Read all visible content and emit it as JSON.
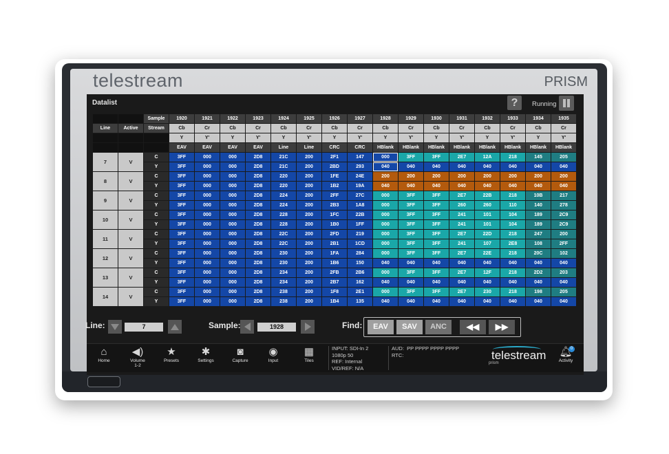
{
  "header": {
    "brand": "telestream",
    "product": "PRISM"
  },
  "app": {
    "title": "Datalist",
    "help_label": "?",
    "status": "Running"
  },
  "table": {
    "labels": {
      "sample": "Sample",
      "line": "Line",
      "active": "Active",
      "stream": "Stream"
    },
    "samples": [
      "1920",
      "1921",
      "1922",
      "1923",
      "1924",
      "1925",
      "1926",
      "1927",
      "1928",
      "1929",
      "1930",
      "1931",
      "1932",
      "1933",
      "1934",
      "1935"
    ],
    "streams": [
      "Cb",
      "Cr",
      "Cb",
      "Cr",
      "Cb",
      "Cr",
      "Cb",
      "Cr",
      "Cb",
      "Cr",
      "Cb",
      "Cr",
      "Cb",
      "Cr",
      "Cb",
      "Cr"
    ],
    "ys": [
      "Y",
      "Y'",
      "Y",
      "Y'",
      "Y",
      "Y'",
      "Y",
      "Y'",
      "Y",
      "Y'",
      "Y",
      "Y'",
      "Y",
      "Y'",
      "Y",
      "Y'"
    ],
    "types": [
      "EAV",
      "EAV",
      "EAV",
      "EAV",
      "Line",
      "Line",
      "CRC",
      "CRC",
      "HBlank",
      "HBlank",
      "HBlank",
      "HBlank",
      "HBlank",
      "HBlank",
      "HBlank",
      "HBlank"
    ],
    "rows": [
      {
        "line": "7",
        "active": "V",
        "c": [
          "3FF",
          "000",
          "000",
          "2D8",
          "21C",
          "200",
          "2F1",
          "147",
          "000",
          "3FF",
          "3FF",
          "2E7",
          "12A",
          "218",
          "145",
          "205"
        ],
        "y": [
          "3FF",
          "000",
          "000",
          "2D8",
          "21C",
          "200",
          "2BD",
          "293",
          "040",
          "040",
          "040",
          "040",
          "040",
          "040",
          "040",
          "040"
        ]
      },
      {
        "line": "8",
        "active": "V",
        "c": [
          "3FF",
          "000",
          "000",
          "2D8",
          "220",
          "200",
          "1FE",
          "24E",
          "200",
          "200",
          "200",
          "200",
          "200",
          "200",
          "200",
          "200"
        ],
        "y": [
          "3FF",
          "000",
          "000",
          "2D8",
          "220",
          "200",
          "1B2",
          "19A",
          "040",
          "040",
          "040",
          "040",
          "040",
          "040",
          "040",
          "040"
        ]
      },
      {
        "line": "9",
        "active": "V",
        "c": [
          "3FF",
          "000",
          "000",
          "2D8",
          "224",
          "200",
          "2FF",
          "27C",
          "000",
          "3FF",
          "3FF",
          "2E7",
          "22B",
          "218",
          "10B",
          "217"
        ],
        "y": [
          "3FF",
          "000",
          "000",
          "2D8",
          "224",
          "200",
          "2B3",
          "1A8",
          "000",
          "3FF",
          "3FF",
          "260",
          "260",
          "110",
          "140",
          "278"
        ]
      },
      {
        "line": "10",
        "active": "V",
        "c": [
          "3FF",
          "000",
          "000",
          "2D8",
          "228",
          "200",
          "1FC",
          "22B",
          "000",
          "3FF",
          "3FF",
          "241",
          "101",
          "104",
          "189",
          "2C9"
        ],
        "y": [
          "3FF",
          "000",
          "000",
          "2D8",
          "228",
          "200",
          "1B0",
          "1FF",
          "000",
          "3FF",
          "3FF",
          "241",
          "101",
          "104",
          "189",
          "2C9"
        ]
      },
      {
        "line": "11",
        "active": "V",
        "c": [
          "3FF",
          "000",
          "000",
          "2D8",
          "22C",
          "200",
          "2FD",
          "219",
          "000",
          "3FF",
          "3FF",
          "2E7",
          "22D",
          "218",
          "247",
          "200"
        ],
        "y": [
          "3FF",
          "000",
          "000",
          "2D8",
          "22C",
          "200",
          "2B1",
          "1CD",
          "000",
          "3FF",
          "3FF",
          "241",
          "107",
          "2E8",
          "108",
          "2FF"
        ]
      },
      {
        "line": "12",
        "active": "V",
        "c": [
          "3FF",
          "000",
          "000",
          "2D8",
          "230",
          "200",
          "1FA",
          "284",
          "000",
          "3FF",
          "3FF",
          "2E7",
          "22E",
          "218",
          "20C",
          "102"
        ],
        "y": [
          "3FF",
          "000",
          "000",
          "2D8",
          "230",
          "200",
          "1B6",
          "150",
          "040",
          "040",
          "040",
          "040",
          "040",
          "040",
          "040",
          "040"
        ]
      },
      {
        "line": "13",
        "active": "V",
        "c": [
          "3FF",
          "000",
          "000",
          "2D8",
          "234",
          "200",
          "2FB",
          "2B6",
          "000",
          "3FF",
          "3FF",
          "2E7",
          "12F",
          "218",
          "2D2",
          "203"
        ],
        "y": [
          "3FF",
          "000",
          "000",
          "2D8",
          "234",
          "200",
          "2B7",
          "162",
          "040",
          "040",
          "040",
          "040",
          "040",
          "040",
          "040",
          "040"
        ]
      },
      {
        "line": "14",
        "active": "V",
        "c": [
          "3FF",
          "000",
          "000",
          "2D8",
          "238",
          "200",
          "1F8",
          "2E1",
          "000",
          "3FF",
          "3FF",
          "2E7",
          "230",
          "218",
          "198",
          "205"
        ],
        "y": [
          "3FF",
          "000",
          "000",
          "2D8",
          "238",
          "200",
          "1B4",
          "135",
          "040",
          "040",
          "040",
          "040",
          "040",
          "040",
          "040",
          "040"
        ]
      }
    ],
    "row_labels": {
      "c": "C",
      "y": "Y"
    }
  },
  "controls": {
    "line_label": "Line:",
    "line_value": "7",
    "sample_label": "Sample:",
    "sample_value": "1928",
    "find_label": "Find:",
    "eav": "EAV",
    "sav": "SAV",
    "anc": "ANC",
    "prev": "◀◀",
    "next": "▶▶"
  },
  "taskbar": {
    "items": [
      {
        "label": "Home",
        "icon": "home-icon"
      },
      {
        "label": "Volume",
        "sub": "1-2",
        "icon": "volume-icon"
      },
      {
        "label": "Presets",
        "icon": "star-icon"
      },
      {
        "label": "Settings",
        "icon": "gear-icon"
      },
      {
        "label": "Capture",
        "icon": "camera-icon"
      },
      {
        "label": "Input",
        "icon": "input-icon"
      },
      {
        "label": "Tiles",
        "icon": "tiles-icon"
      }
    ],
    "input": "INPUT: SDI-In 2",
    "format": "1080p 50",
    "ref": "REF: Internal",
    "vidref": "VID/REF: N/A",
    "aud_label": "AUD:",
    "aud_value": "PP PPPP PPPP PPPP",
    "rtc": "RTC:",
    "logo": "telestream",
    "logo_sub": "prism",
    "activity": "Activity",
    "activity_count": "0"
  },
  "colors": {
    "eav_blue": "#1447a7",
    "hblank_teal": "#1aa7a8",
    "hblank_orange": "#b35a0d"
  }
}
